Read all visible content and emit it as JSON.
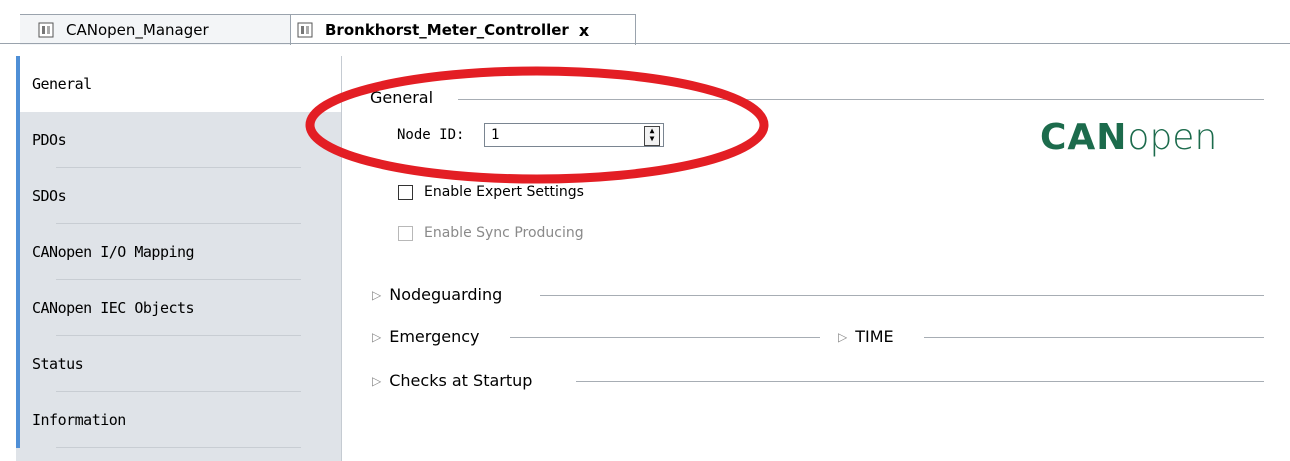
{
  "tabs": [
    {
      "label": "CANopen_Manager"
    },
    {
      "label": "Bronkhorst_Meter_Controller",
      "close": "x"
    }
  ],
  "sidebar": {
    "items": [
      {
        "label": "General"
      },
      {
        "label": "PDOs"
      },
      {
        "label": "SDOs"
      },
      {
        "label": "CANopen I/O Mapping"
      },
      {
        "label": "CANopen IEC Objects"
      },
      {
        "label": "Status"
      },
      {
        "label": "Information"
      }
    ]
  },
  "general": {
    "title": "General",
    "node_id_label": "Node ID:",
    "node_id_value": "1",
    "expert_settings": "Enable Expert Settings",
    "sync_producing": "Enable Sync Producing"
  },
  "sections": {
    "nodeguarding": "Nodeguarding",
    "emergency": "Emergency",
    "time": "TIME",
    "checks": "Checks at Startup"
  },
  "logo": {
    "bold": "CAN",
    "light": "open",
    "color": "#1c6b4c"
  },
  "annotation": {
    "ellipse_color": "#e31e24"
  },
  "icons": [
    "module-icon",
    "spin-arrows-icon",
    "expand-triangle-icon",
    "close-icon"
  ]
}
